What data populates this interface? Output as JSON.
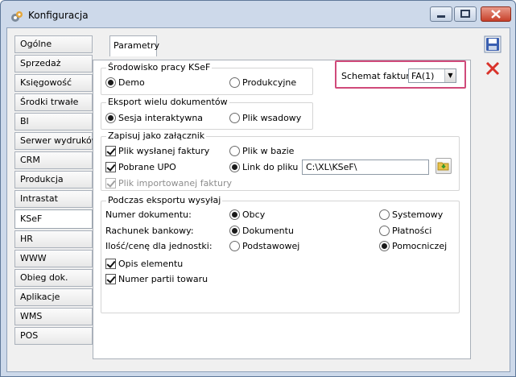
{
  "window": {
    "title": "Konfiguracja"
  },
  "sidebar": {
    "items": [
      {
        "label": "Ogólne"
      },
      {
        "label": "Sprzedaż"
      },
      {
        "label": "Księgowość"
      },
      {
        "label": "Środki trwałe"
      },
      {
        "label": "BI"
      },
      {
        "label": "Serwer wydruków"
      },
      {
        "label": "CRM"
      },
      {
        "label": "Produkcja"
      },
      {
        "label": "Intrastat"
      },
      {
        "label": "KSeF"
      },
      {
        "label": "HR"
      },
      {
        "label": "WWW"
      },
      {
        "label": "Obieg dok."
      },
      {
        "label": "Aplikacje"
      },
      {
        "label": "WMS"
      },
      {
        "label": "POS"
      }
    ],
    "active": "KSeF"
  },
  "tab": {
    "label": "Parametry"
  },
  "srodowisko": {
    "title": "Środowisko pracy KSeF",
    "demo": "Demo",
    "produkcyjne": "Produkcyjne",
    "selected": "Demo"
  },
  "schemat": {
    "label": "Schemat faktury:",
    "value": "FA(1)"
  },
  "eksport": {
    "title": "Eksport wielu dokumentów",
    "sesja": "Sesja interaktywna",
    "plik_wsadowy": "Plik wsadowy",
    "selected": "Sesja interaktywna"
  },
  "zapisuj": {
    "title": "Zapisuj jako załącznik",
    "plik_wyslanej": "Plik wysłanej faktury",
    "pobrane_upo": "Pobrane UPO",
    "plik_importowanej": "Plik importowanej faktury",
    "plik_w_bazie": "Plik w bazie",
    "link_do_pliku": "Link do pliku",
    "path": "C:\\XL\\KSeF\\"
  },
  "podczas": {
    "title": "Podczas eksportu wysyłaj",
    "numer_label": "Numer dokumentu:",
    "numer_opt1": "Obcy",
    "numer_opt2": "Systemowy",
    "rachunek_label": "Rachunek bankowy:",
    "rachunek_opt1": "Dokumentu",
    "rachunek_opt2": "Płatności",
    "ilosc_label": "Ilość/cenę dla jednostki:",
    "ilosc_opt1": "Podstawowej",
    "ilosc_opt2": "Pomocniczej",
    "opis": "Opis elementu",
    "numer_partii": "Numer partii towaru"
  },
  "colors": {
    "highlight": "#d04a7a",
    "window_frame": "#cdd9ea"
  }
}
